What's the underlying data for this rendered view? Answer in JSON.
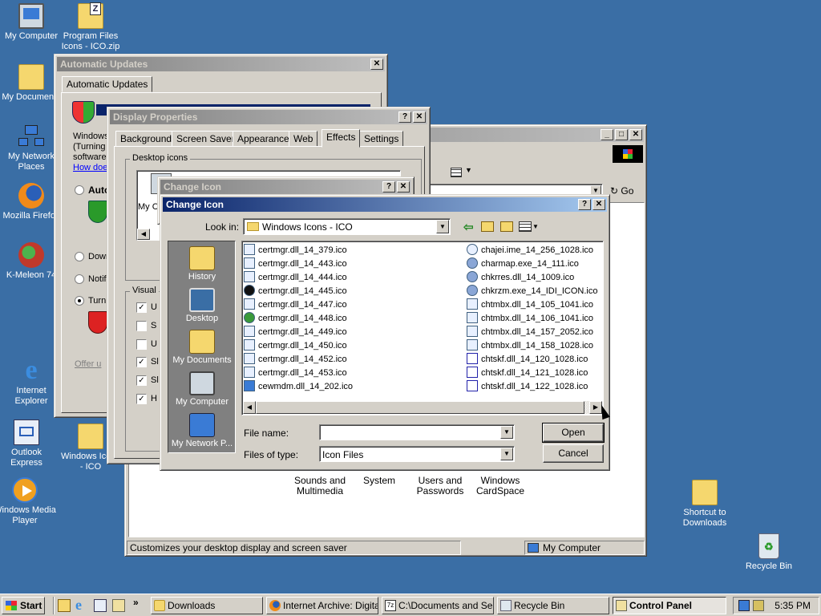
{
  "desktop": {
    "icons": [
      {
        "label": "My Computer"
      },
      {
        "label": "Program Files Icons - ICO.zip"
      },
      {
        "label": "My Documents"
      },
      {
        "label": "My Network Places"
      },
      {
        "label": "Mozilla Firefox"
      },
      {
        "label": "K-Meleon 74"
      },
      {
        "label": "Internet Explorer"
      },
      {
        "label": "Outlook Express"
      },
      {
        "label": "Windows Icons - ICO"
      },
      {
        "label": "Windows Media Player"
      },
      {
        "label": "Shortcut to Downloads"
      },
      {
        "label": "Recycle Bin"
      }
    ]
  },
  "control_panel": {
    "address_go": "Go",
    "items": [
      "Sounds and Multimedia",
      "System",
      "Users and Passwords",
      "Windows CardSpace"
    ],
    "status_left": "Customizes your desktop display and screen saver",
    "status_right": "My Computer"
  },
  "auto_updates": {
    "title": "Automatic Updates",
    "tab": "Automatic Updates",
    "text1": "Windows",
    "text2": "(Turning",
    "text3": "software",
    "link": "How doe",
    "radio_auto": "Auto",
    "radio_down": "Down",
    "radio_notif": "Notif",
    "radio_turn": "Turn",
    "offer": "Offer u"
  },
  "display_props": {
    "title": "Display Properties",
    "tabs": [
      "Background",
      "Screen Saver",
      "Appearance",
      "Web",
      "Effects",
      "Settings"
    ],
    "active_tab": "Effects",
    "group_desktop_icons": "Desktop icons",
    "my_c": "My C",
    "group_visual": "Visual",
    "checks": [
      {
        "label": "U",
        "checked": true
      },
      {
        "label": "S",
        "checked": false
      },
      {
        "label": "U",
        "checked": false
      },
      {
        "label": "Sl",
        "checked": true
      },
      {
        "label": "Sl",
        "checked": true
      },
      {
        "label": "H",
        "checked": true
      }
    ]
  },
  "change_icon_back": {
    "title": "Change Icon"
  },
  "dialog": {
    "title": "Change Icon",
    "look_in_label": "Look in:",
    "look_in_value": "Windows Icons - ICO",
    "places": [
      "History",
      "Desktop",
      "My Documents",
      "My Computer",
      "My Network P..."
    ],
    "files_left": [
      "certmgr.dll_14_379.ico",
      "certmgr.dll_14_443.ico",
      "certmgr.dll_14_444.ico",
      "certmgr.dll_14_445.ico",
      "certmgr.dll_14_447.ico",
      "certmgr.dll_14_448.ico",
      "certmgr.dll_14_449.ico",
      "certmgr.dll_14_450.ico",
      "certmgr.dll_14_452.ico",
      "certmgr.dll_14_453.ico",
      "cewmdm.dll_14_202.ico"
    ],
    "files_right": [
      "chajei.ime_14_256_1028.ico",
      "charmap.exe_14_111.ico",
      "chkrres.dll_14_1009.ico",
      "chkrzm.exe_14_IDI_ICON.ico",
      "chtmbx.dll_14_105_1041.ico",
      "chtmbx.dll_14_106_1041.ico",
      "chtmbx.dll_14_157_2052.ico",
      "chtmbx.dll_14_158_1028.ico",
      "chtskf.dll_14_120_1028.ico",
      "chtskf.dll_14_121_1028.ico",
      "chtskf.dll_14_122_1028.ico"
    ],
    "file_name_label": "File name:",
    "file_name_value": "",
    "files_of_type_label": "Files of type:",
    "files_of_type_value": "Icon Files",
    "open": "Open",
    "cancel": "Cancel"
  },
  "taskbar": {
    "start": "Start",
    "tasks": [
      {
        "label": "Downloads",
        "pressed": false
      },
      {
        "label": "Internet Archive: Digita...",
        "pressed": false
      },
      {
        "label": "C:\\Documents and Se...",
        "pressed": false
      },
      {
        "label": "Recycle Bin",
        "pressed": false
      },
      {
        "label": "Control Panel",
        "pressed": true
      }
    ],
    "clock": "5:35 PM"
  }
}
